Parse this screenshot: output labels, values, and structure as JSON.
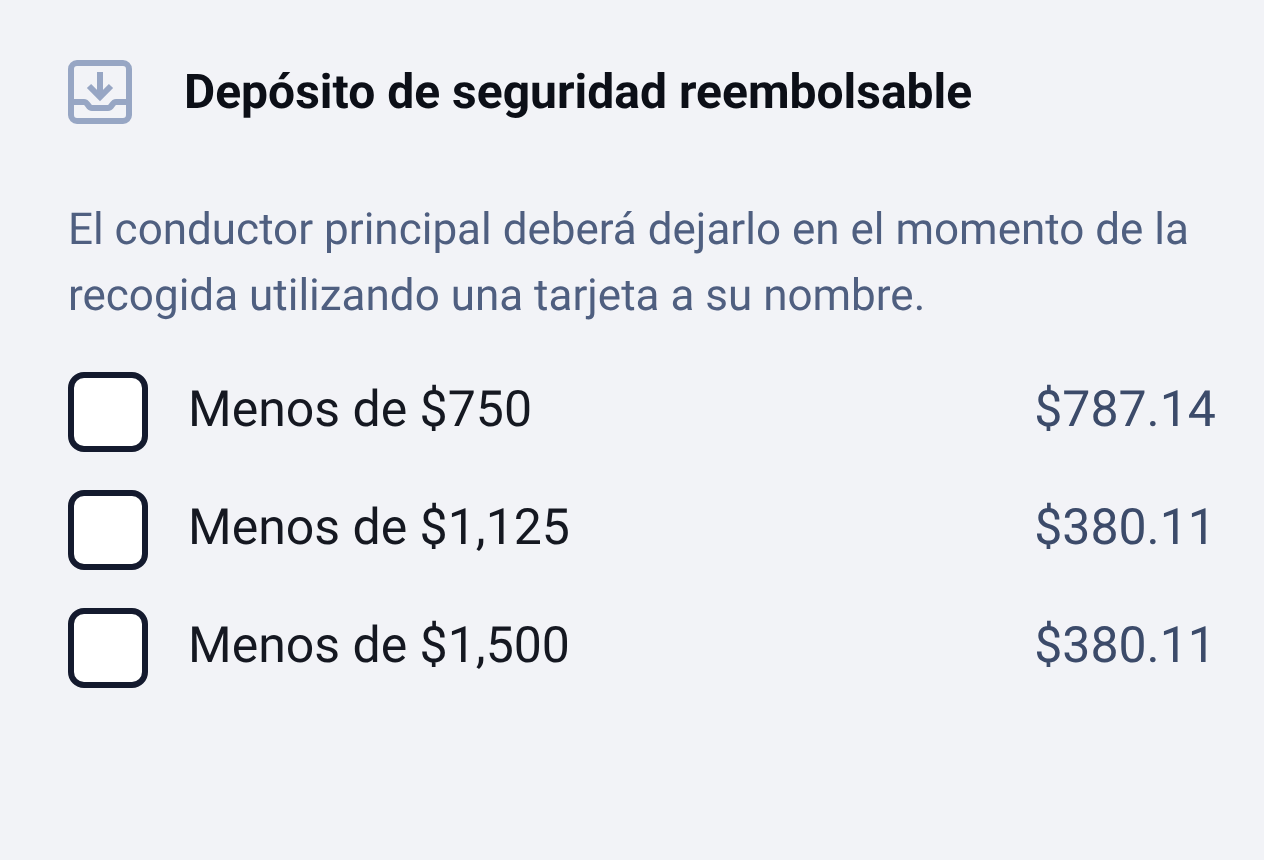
{
  "section": {
    "title": "Depósito de seguridad reembolsable",
    "description": "El conductor principal deberá dejarlo en el momento de la recogida utilizando una tarjeta a su nombre."
  },
  "options": [
    {
      "label": "Menos de $750",
      "price": "$787.14",
      "checked": false
    },
    {
      "label": "Menos de $1,125",
      "price": "$380.11",
      "checked": false
    },
    {
      "label": "Menos de $1,500",
      "price": "$380.11",
      "checked": false
    }
  ]
}
